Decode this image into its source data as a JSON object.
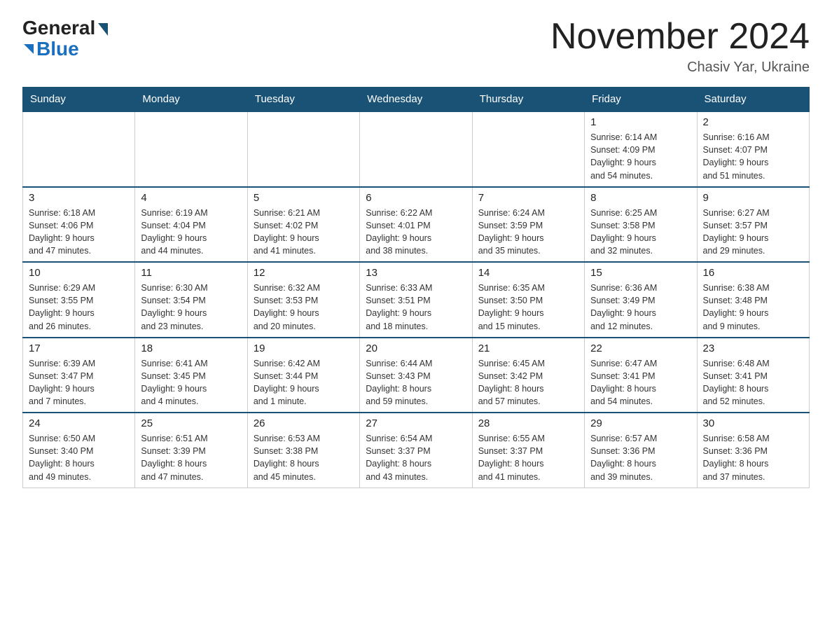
{
  "logo": {
    "general": "General",
    "blue": "Blue"
  },
  "title": "November 2024",
  "location": "Chasiv Yar, Ukraine",
  "days_of_week": [
    "Sunday",
    "Monday",
    "Tuesday",
    "Wednesday",
    "Thursday",
    "Friday",
    "Saturday"
  ],
  "weeks": [
    [
      {
        "day": "",
        "info": ""
      },
      {
        "day": "",
        "info": ""
      },
      {
        "day": "",
        "info": ""
      },
      {
        "day": "",
        "info": ""
      },
      {
        "day": "",
        "info": ""
      },
      {
        "day": "1",
        "info": "Sunrise: 6:14 AM\nSunset: 4:09 PM\nDaylight: 9 hours\nand 54 minutes."
      },
      {
        "day": "2",
        "info": "Sunrise: 6:16 AM\nSunset: 4:07 PM\nDaylight: 9 hours\nand 51 minutes."
      }
    ],
    [
      {
        "day": "3",
        "info": "Sunrise: 6:18 AM\nSunset: 4:06 PM\nDaylight: 9 hours\nand 47 minutes."
      },
      {
        "day": "4",
        "info": "Sunrise: 6:19 AM\nSunset: 4:04 PM\nDaylight: 9 hours\nand 44 minutes."
      },
      {
        "day": "5",
        "info": "Sunrise: 6:21 AM\nSunset: 4:02 PM\nDaylight: 9 hours\nand 41 minutes."
      },
      {
        "day": "6",
        "info": "Sunrise: 6:22 AM\nSunset: 4:01 PM\nDaylight: 9 hours\nand 38 minutes."
      },
      {
        "day": "7",
        "info": "Sunrise: 6:24 AM\nSunset: 3:59 PM\nDaylight: 9 hours\nand 35 minutes."
      },
      {
        "day": "8",
        "info": "Sunrise: 6:25 AM\nSunset: 3:58 PM\nDaylight: 9 hours\nand 32 minutes."
      },
      {
        "day": "9",
        "info": "Sunrise: 6:27 AM\nSunset: 3:57 PM\nDaylight: 9 hours\nand 29 minutes."
      }
    ],
    [
      {
        "day": "10",
        "info": "Sunrise: 6:29 AM\nSunset: 3:55 PM\nDaylight: 9 hours\nand 26 minutes."
      },
      {
        "day": "11",
        "info": "Sunrise: 6:30 AM\nSunset: 3:54 PM\nDaylight: 9 hours\nand 23 minutes."
      },
      {
        "day": "12",
        "info": "Sunrise: 6:32 AM\nSunset: 3:53 PM\nDaylight: 9 hours\nand 20 minutes."
      },
      {
        "day": "13",
        "info": "Sunrise: 6:33 AM\nSunset: 3:51 PM\nDaylight: 9 hours\nand 18 minutes."
      },
      {
        "day": "14",
        "info": "Sunrise: 6:35 AM\nSunset: 3:50 PM\nDaylight: 9 hours\nand 15 minutes."
      },
      {
        "day": "15",
        "info": "Sunrise: 6:36 AM\nSunset: 3:49 PM\nDaylight: 9 hours\nand 12 minutes."
      },
      {
        "day": "16",
        "info": "Sunrise: 6:38 AM\nSunset: 3:48 PM\nDaylight: 9 hours\nand 9 minutes."
      }
    ],
    [
      {
        "day": "17",
        "info": "Sunrise: 6:39 AM\nSunset: 3:47 PM\nDaylight: 9 hours\nand 7 minutes."
      },
      {
        "day": "18",
        "info": "Sunrise: 6:41 AM\nSunset: 3:45 PM\nDaylight: 9 hours\nand 4 minutes."
      },
      {
        "day": "19",
        "info": "Sunrise: 6:42 AM\nSunset: 3:44 PM\nDaylight: 9 hours\nand 1 minute."
      },
      {
        "day": "20",
        "info": "Sunrise: 6:44 AM\nSunset: 3:43 PM\nDaylight: 8 hours\nand 59 minutes."
      },
      {
        "day": "21",
        "info": "Sunrise: 6:45 AM\nSunset: 3:42 PM\nDaylight: 8 hours\nand 57 minutes."
      },
      {
        "day": "22",
        "info": "Sunrise: 6:47 AM\nSunset: 3:41 PM\nDaylight: 8 hours\nand 54 minutes."
      },
      {
        "day": "23",
        "info": "Sunrise: 6:48 AM\nSunset: 3:41 PM\nDaylight: 8 hours\nand 52 minutes."
      }
    ],
    [
      {
        "day": "24",
        "info": "Sunrise: 6:50 AM\nSunset: 3:40 PM\nDaylight: 8 hours\nand 49 minutes."
      },
      {
        "day": "25",
        "info": "Sunrise: 6:51 AM\nSunset: 3:39 PM\nDaylight: 8 hours\nand 47 minutes."
      },
      {
        "day": "26",
        "info": "Sunrise: 6:53 AM\nSunset: 3:38 PM\nDaylight: 8 hours\nand 45 minutes."
      },
      {
        "day": "27",
        "info": "Sunrise: 6:54 AM\nSunset: 3:37 PM\nDaylight: 8 hours\nand 43 minutes."
      },
      {
        "day": "28",
        "info": "Sunrise: 6:55 AM\nSunset: 3:37 PM\nDaylight: 8 hours\nand 41 minutes."
      },
      {
        "day": "29",
        "info": "Sunrise: 6:57 AM\nSunset: 3:36 PM\nDaylight: 8 hours\nand 39 minutes."
      },
      {
        "day": "30",
        "info": "Sunrise: 6:58 AM\nSunset: 3:36 PM\nDaylight: 8 hours\nand 37 minutes."
      }
    ]
  ]
}
